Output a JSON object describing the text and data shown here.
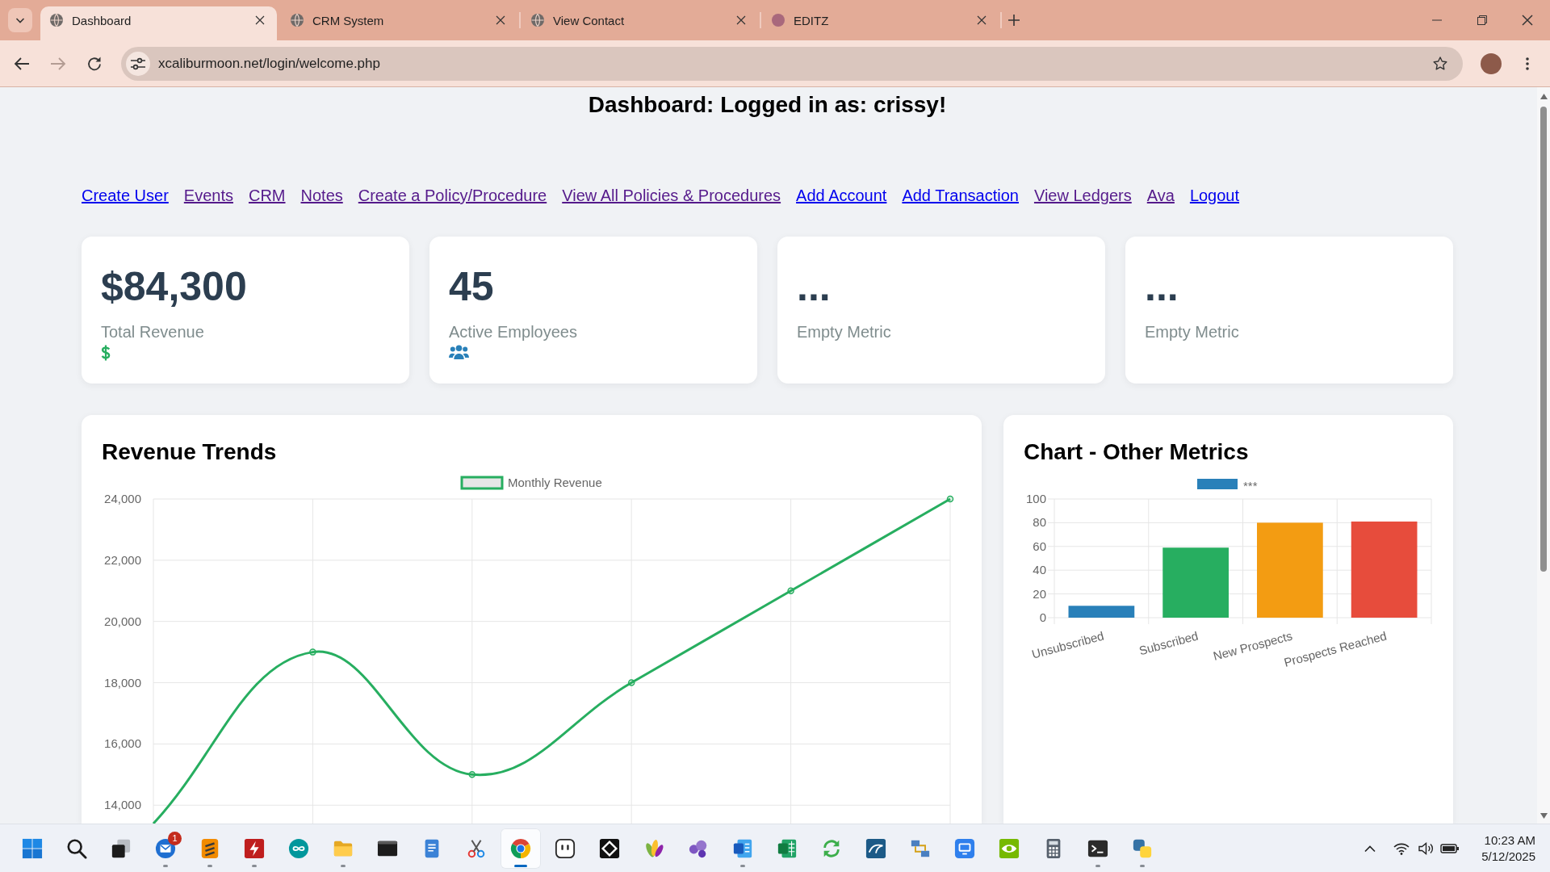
{
  "browser": {
    "tabs": [
      {
        "title": "Dashboard",
        "kind": "globe",
        "selected": true
      },
      {
        "title": "CRM System",
        "kind": "globe",
        "selected": false
      },
      {
        "title": "View Contact",
        "kind": "globe",
        "selected": false
      },
      {
        "title": "EDITZ",
        "kind": "avatar",
        "selected": false
      }
    ],
    "nav_buttons": [
      {
        "kind": "back",
        "disabled": false
      },
      {
        "kind": "forward",
        "disabled": true
      },
      {
        "kind": "reload",
        "disabled": false
      }
    ],
    "address": "xcaliburmoon.net/login/welcome.php"
  },
  "page": {
    "heading": "Dashboard: Logged in as: crissy!",
    "nav_links": [
      {
        "label": "Create User",
        "visited": false
      },
      {
        "label": "Events",
        "visited": true
      },
      {
        "label": "CRM",
        "visited": true
      },
      {
        "label": "Notes",
        "visited": true
      },
      {
        "label": "Create a Policy/Procedure",
        "visited": true
      },
      {
        "label": "View All Policies & Procedures",
        "visited": true
      },
      {
        "label": "Add Account",
        "visited": false
      },
      {
        "label": "Add Transaction",
        "visited": false
      },
      {
        "label": "View Ledgers",
        "visited": true
      },
      {
        "label": "Ava",
        "visited": true
      },
      {
        "label": "Logout",
        "visited": false
      }
    ],
    "metrics": [
      {
        "kind": "money",
        "value": "$84,300",
        "label": "Total Revenue"
      },
      {
        "kind": "people",
        "value": "45",
        "label": "Active Employees"
      },
      {
        "kind": "empty",
        "value": "...",
        "label": "Empty Metric"
      },
      {
        "kind": "empty",
        "value": "...",
        "label": "Empty Metric"
      }
    ],
    "revenue_trends": {
      "title": "Revenue Trends",
      "chart_data": {
        "type": "line",
        "categories": [
          null,
          null,
          null,
          null,
          null,
          null
        ],
        "series": [
          {
            "name": "Monthly Revenue",
            "color": "#27ae60",
            "marker": "circle",
            "values": [
              13400,
              19000,
              15000,
              18000,
              21000,
              24000
            ]
          }
        ],
        "ylim": [
          13400,
          24000
        ],
        "yticks": [
          {
            "value": 14000,
            "label": "14,000"
          },
          {
            "value": 16000,
            "label": "16,000"
          },
          {
            "value": 18000,
            "label": "18,000"
          },
          {
            "value": 20000,
            "label": "20,000"
          },
          {
            "value": 22000,
            "label": "22,000"
          },
          {
            "value": 24000,
            "label": "24,000"
          }
        ],
        "grid": true
      }
    },
    "other_metrics": {
      "title": "Chart - Other Metrics",
      "chart_data": {
        "type": "bar",
        "categories": [
          "Unsubscribed",
          "Subscribed",
          "New Prospects",
          "Prospects Reached"
        ],
        "series": [
          {
            "name": "***",
            "colors": [
              "#2980b9",
              "#27ae60",
              "#f39c12",
              "#e74c3c"
            ],
            "values": [
              10,
              59,
              80,
              81
            ]
          }
        ],
        "ylim": [
          0,
          100
        ],
        "yticks": [
          0,
          20,
          40,
          60,
          80,
          100
        ],
        "grid": true
      }
    }
  },
  "taskbar": {
    "apps": [
      {
        "kind": "start",
        "running": false,
        "selected": false
      },
      {
        "kind": "search",
        "running": false,
        "selected": false
      },
      {
        "kind": "taskview",
        "running": false,
        "selected": false
      },
      {
        "kind": "mail",
        "running": true,
        "selected": false,
        "badge": "1"
      },
      {
        "kind": "editor",
        "running": true,
        "selected": false
      },
      {
        "kind": "ftp",
        "running": true,
        "selected": false
      },
      {
        "kind": "infinity",
        "running": false,
        "selected": false
      },
      {
        "kind": "folder",
        "running": true,
        "selected": false
      },
      {
        "kind": "console",
        "running": false,
        "selected": false
      },
      {
        "kind": "notepad",
        "running": false,
        "selected": false
      },
      {
        "kind": "snip",
        "running": false,
        "selected": false
      },
      {
        "kind": "browser",
        "running": true,
        "selected": true
      },
      {
        "kind": "robot",
        "running": false,
        "selected": false
      },
      {
        "kind": "diamond",
        "running": false,
        "selected": false
      },
      {
        "kind": "leaves",
        "running": false,
        "selected": false
      },
      {
        "kind": "bubbles",
        "running": false,
        "selected": false
      },
      {
        "kind": "document",
        "running": true,
        "selected": false
      },
      {
        "kind": "spreadsheet",
        "running": false,
        "selected": false
      },
      {
        "kind": "sync",
        "running": false,
        "selected": false
      },
      {
        "kind": "database",
        "running": false,
        "selected": false
      },
      {
        "kind": "network",
        "running": false,
        "selected": false
      },
      {
        "kind": "remote",
        "running": false,
        "selected": false
      },
      {
        "kind": "eye",
        "running": false,
        "selected": false
      },
      {
        "kind": "calculator",
        "running": false,
        "selected": false
      },
      {
        "kind": "terminal",
        "running": true,
        "selected": false
      },
      {
        "kind": "python",
        "running": true,
        "selected": false
      }
    ],
    "tray": [
      {
        "kind": "chevron"
      },
      {
        "kind": "wifi"
      },
      {
        "kind": "volume"
      },
      {
        "kind": "battery"
      }
    ],
    "clock": {
      "time": "10:23 AM",
      "date": "5/12/2025"
    }
  }
}
